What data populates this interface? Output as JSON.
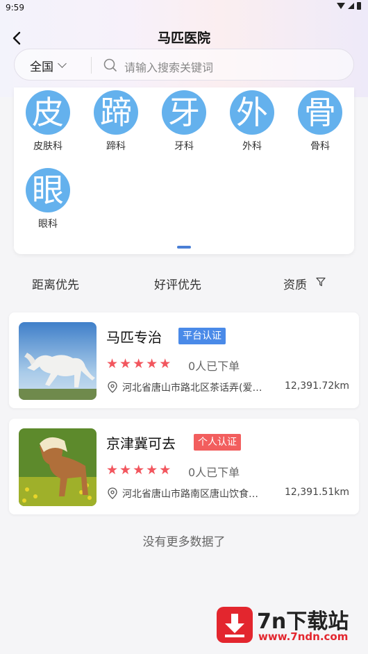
{
  "status_bar": {
    "time": "9:59"
  },
  "header": {
    "title": "马匹医院"
  },
  "search": {
    "region": "全国",
    "placeholder": "请输入搜索关键词"
  },
  "categories": [
    {
      "glyph": "皮",
      "label": "皮肤科"
    },
    {
      "glyph": "蹄",
      "label": "蹄科"
    },
    {
      "glyph": "牙",
      "label": "牙科"
    },
    {
      "glyph": "外",
      "label": "外科"
    },
    {
      "glyph": "骨",
      "label": "骨科"
    },
    {
      "glyph": "眼",
      "label": "眼科"
    }
  ],
  "sort": {
    "distance": "距离优先",
    "rating": "好评优先",
    "qualification": "资质"
  },
  "shops": [
    {
      "name": "马匹专治",
      "badge": "平台认证",
      "badge_color": "#4a8ae8",
      "orders": "0人已下单",
      "address": "河北省唐山市路北区茶话弄(爱…",
      "distance": "12,391.72km",
      "rating": 5
    },
    {
      "name": "京津冀可去",
      "badge": "个人认证",
      "badge_color": "#f25e5e",
      "orders": "0人已下单",
      "address": "河北省唐山市路南区唐山饮食…",
      "distance": "12,391.51km",
      "rating": 5
    }
  ],
  "footer": {
    "no_more": "没有更多数据了"
  },
  "watermark": {
    "brand": "7n下载站",
    "url": "www.7ndn.com"
  },
  "colors": {
    "accent": "#4a7fd6",
    "category_circle": "#64b1ed",
    "star": "#f2565e"
  }
}
